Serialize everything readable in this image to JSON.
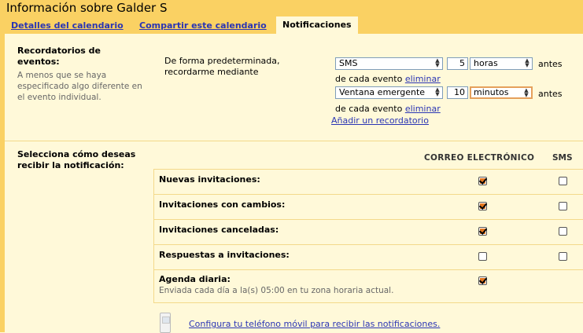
{
  "header": {
    "title": "Información sobre Galder S"
  },
  "tabs": [
    {
      "label": "Detalles del calendario",
      "active": false
    },
    {
      "label": "Compartir este calendario",
      "active": false
    },
    {
      "label": "Notificaciones",
      "active": true
    }
  ],
  "reminders": {
    "heading": "Recordatorios de eventos:",
    "heading_line1": "Recordatorios de",
    "heading_line2": "eventos:",
    "description": "A menos que se haya especificado algo diferente en el evento individual.",
    "default_label": "De forma predeterminada, recordarme mediante",
    "items": [
      {
        "method": "SMS",
        "amount": "5",
        "unit": "horas",
        "suffix": "antes",
        "tail": "de cada evento",
        "remove": "eliminar"
      },
      {
        "method": "Ventana emergente",
        "amount": "10",
        "unit": "minutos",
        "suffix": "antes",
        "tail": "de cada evento",
        "remove": "eliminar"
      }
    ],
    "add_link": "Añadir un recordatorio"
  },
  "notifications": {
    "heading": "Selecciona cómo deseas recibir la notificación:",
    "col_email": "CORREO ELECTRÓNICO",
    "col_sms": "SMS",
    "rows": [
      {
        "label": "Nuevas invitaciones:",
        "email": true,
        "sms": false
      },
      {
        "label": "Invitaciones con cambios:",
        "email": true,
        "sms": false
      },
      {
        "label": "Invitaciones canceladas:",
        "email": true,
        "sms": false
      },
      {
        "label": "Respuestas a invitaciones:",
        "email": false,
        "sms": false
      },
      {
        "label": "Agenda diaria:",
        "sub": "Enviada cada día a la(s) 05:00 en tu zona horaria actual.",
        "email": true
      }
    ],
    "phone_link": "Configura tu teléfono móvil para recibir las notificaciones."
  },
  "colors": {
    "header_bg": "#fad163",
    "panel_bg": "#fff9d9",
    "link": "#2a35b4",
    "check_fill": "#e2761f"
  },
  "icons": {
    "phone": "mobile-phone-icon"
  }
}
